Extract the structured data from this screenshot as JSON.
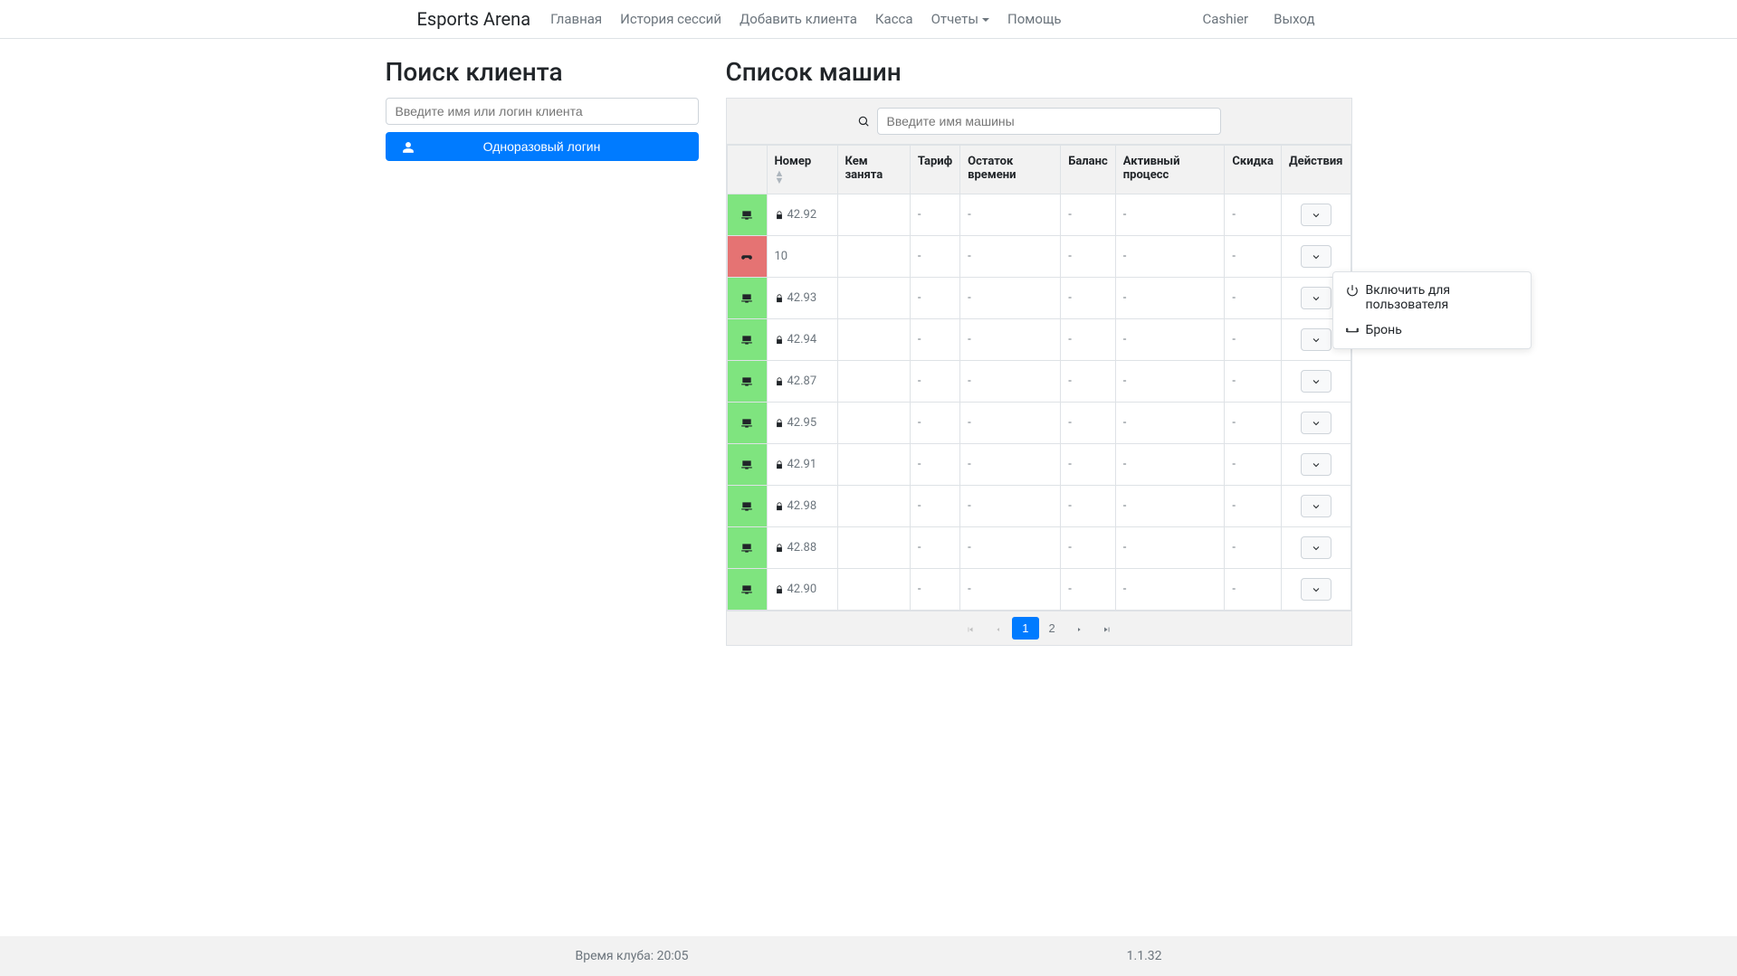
{
  "brand": "Esports Arena",
  "nav": {
    "main": "Главная",
    "sessions": "История сессий",
    "add_client": "Добавить клиента",
    "cashier": "Касса",
    "reports": "Отчеты",
    "help": "Помощь",
    "user": "Cashier",
    "logout": "Выход"
  },
  "left": {
    "title": "Поиск клиента",
    "search_placeholder": "Введите имя или логин клиента",
    "one_time_login": "Одноразовый логин"
  },
  "right": {
    "title": "Список машин",
    "search_placeholder": "Введите имя машины",
    "columns": {
      "number": "Номер",
      "occupied_by": "Кем занята",
      "tariff": "Тариф",
      "time_left": "Остаток времени",
      "balance": "Баланс",
      "active_process": "Активный процесс",
      "discount": "Скидка",
      "actions": "Действия"
    },
    "rows": [
      {
        "status": "green",
        "icon": "pc",
        "number": "42.92",
        "locked": true,
        "occupied_by": "",
        "tariff": "-",
        "time_left": "-",
        "balance": "-",
        "active_process": "-",
        "discount": "-"
      },
      {
        "status": "red",
        "icon": "gamepad",
        "number": "10",
        "locked": false,
        "occupied_by": "",
        "tariff": "-",
        "time_left": "-",
        "balance": "-",
        "active_process": "-",
        "discount": "-",
        "menu_open": true
      },
      {
        "status": "green",
        "icon": "pc",
        "number": "42.93",
        "locked": true,
        "occupied_by": "",
        "tariff": "-",
        "time_left": "-",
        "balance": "-",
        "active_process": "-",
        "discount": "-"
      },
      {
        "status": "green",
        "icon": "pc",
        "number": "42.94",
        "locked": true,
        "occupied_by": "",
        "tariff": "-",
        "time_left": "-",
        "balance": "-",
        "active_process": "-",
        "discount": "-"
      },
      {
        "status": "green",
        "icon": "pc",
        "number": "42.87",
        "locked": true,
        "occupied_by": "",
        "tariff": "-",
        "time_left": "-",
        "balance": "-",
        "active_process": "-",
        "discount": "-"
      },
      {
        "status": "green",
        "icon": "pc",
        "number": "42.95",
        "locked": true,
        "occupied_by": "",
        "tariff": "-",
        "time_left": "-",
        "balance": "-",
        "active_process": "-",
        "discount": "-"
      },
      {
        "status": "green",
        "icon": "pc",
        "number": "42.91",
        "locked": true,
        "occupied_by": "",
        "tariff": "-",
        "time_left": "-",
        "balance": "-",
        "active_process": "-",
        "discount": "-"
      },
      {
        "status": "green",
        "icon": "pc",
        "number": "42.98",
        "locked": true,
        "occupied_by": "",
        "tariff": "-",
        "time_left": "-",
        "balance": "-",
        "active_process": "-",
        "discount": "-"
      },
      {
        "status": "green",
        "icon": "pc",
        "number": "42.88",
        "locked": true,
        "occupied_by": "",
        "tariff": "-",
        "time_left": "-",
        "balance": "-",
        "active_process": "-",
        "discount": "-"
      },
      {
        "status": "green",
        "icon": "pc",
        "number": "42.90",
        "locked": true,
        "occupied_by": "",
        "tariff": "-",
        "time_left": "-",
        "balance": "-",
        "active_process": "-",
        "discount": "-"
      }
    ],
    "row_menu": {
      "power_on": "Включить для пользователя",
      "reserve": "Бронь"
    },
    "pagination": {
      "pages": [
        "1",
        "2"
      ],
      "active": "1"
    }
  },
  "footer": {
    "club_time_label": "Время клуба:",
    "club_time": "20:05",
    "version": "1.1.32"
  }
}
